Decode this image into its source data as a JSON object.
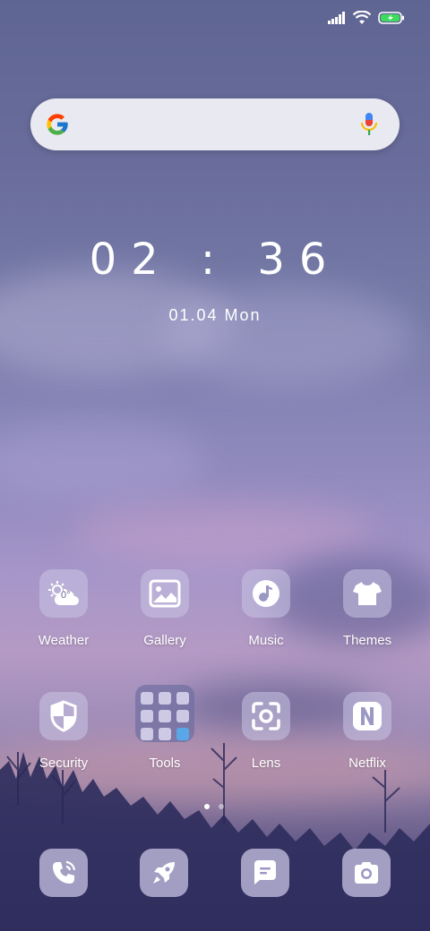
{
  "status_bar": {
    "icons": [
      "signal-icon",
      "wifi-icon",
      "battery-charging-icon"
    ]
  },
  "search": {
    "logo": "google-logo-icon",
    "mic": "mic-icon"
  },
  "clock": {
    "time": "02 : 36",
    "date": "01.04 Mon"
  },
  "apps": [
    {
      "label": "Weather",
      "icon": "weather-icon"
    },
    {
      "label": "Gallery",
      "icon": "gallery-icon"
    },
    {
      "label": "Music",
      "icon": "music-icon"
    },
    {
      "label": "Themes",
      "icon": "themes-icon"
    },
    {
      "label": "Security",
      "icon": "shield-icon"
    },
    {
      "label": "Tools",
      "icon": "folder-icon"
    },
    {
      "label": "Lens",
      "icon": "lens-icon"
    },
    {
      "label": "Netflix",
      "icon": "netflix-icon"
    }
  ],
  "weather": {
    "temp": "0°"
  },
  "page_indicator": {
    "pages": 2,
    "active": 1
  },
  "dock": [
    {
      "icon": "phone-icon"
    },
    {
      "icon": "rocket-icon"
    },
    {
      "icon": "messages-icon"
    },
    {
      "icon": "camera-icon"
    }
  ],
  "colors": {
    "accent": "#c8c4e4",
    "icon_fg": "#ffffff",
    "search_bg": "#e9eaf1"
  }
}
